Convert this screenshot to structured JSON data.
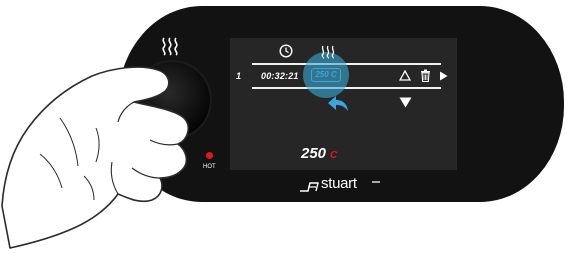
{
  "colors": {
    "panel": "#121212",
    "screen": "#262626",
    "accent": "#3aa6d9",
    "hot": "#e8161b"
  },
  "icons": {
    "heat_left": "heat-waves-icon",
    "clock": "clock-icon",
    "steam": "heat-waves-icon",
    "up": "triangle-up-outline-icon",
    "trash": "trash-icon",
    "play": "play-icon",
    "back": "back-arrow-icon",
    "down": "triangle-down-icon"
  },
  "indicator": {
    "hot_label": "HOT"
  },
  "program_row": {
    "number": "1",
    "time": "00:32:21",
    "temperature": "250 C"
  },
  "current": {
    "value": "250",
    "unit": "C"
  },
  "brand": {
    "name": "stuart"
  }
}
